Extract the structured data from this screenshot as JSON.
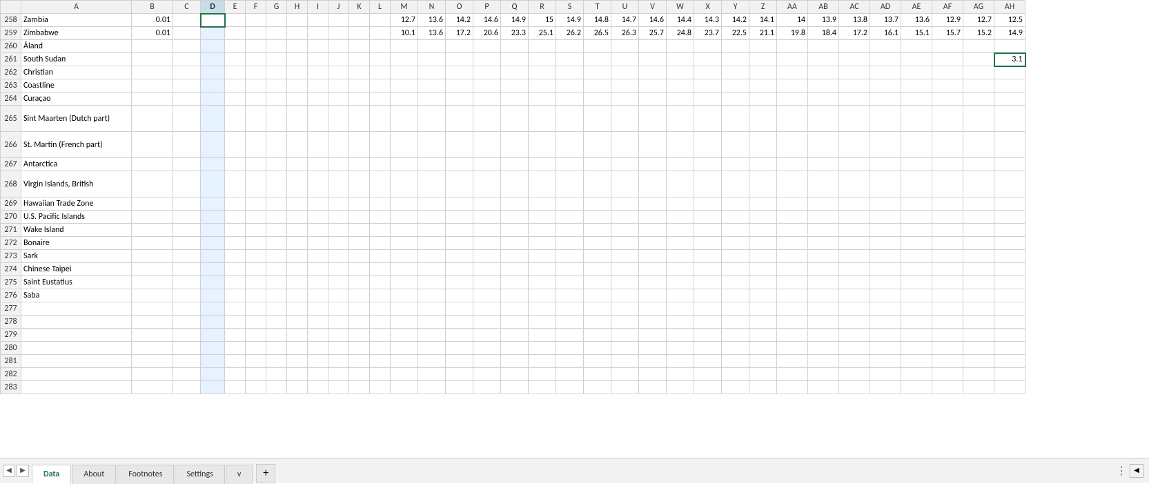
{
  "tabs": [
    {
      "label": "Data",
      "active": true
    },
    {
      "label": "About",
      "active": false
    },
    {
      "label": "Footnotes",
      "active": false
    },
    {
      "label": "Settings",
      "active": false
    },
    {
      "label": "v",
      "active": false
    }
  ],
  "tab_add_label": "+",
  "columns": [
    "",
    "A",
    "B",
    "C",
    "D",
    "E",
    "F",
    "G",
    "H",
    "I",
    "J",
    "K",
    "L",
    "M",
    "N",
    "O",
    "P",
    "Q",
    "R",
    "S",
    "T",
    "U",
    "V",
    "W",
    "X",
    "Y",
    "Z",
    "AA",
    "AB",
    "AC",
    "AD",
    "AE",
    "AF",
    "AG",
    "AH"
  ],
  "rows": [
    {
      "num": 258,
      "a": "Zambia",
      "b": "0.01",
      "c": "",
      "d": "",
      "e": "",
      "f": "",
      "g": "",
      "h": "",
      "i": "",
      "j": "",
      "k": "",
      "l": "",
      "m": "12.7",
      "n": "13.6",
      "o": "14.2",
      "p": "14.6",
      "q": "14.9",
      "r": "15",
      "s": "14.9",
      "t": "14.8",
      "u": "14.7",
      "v": "14.6",
      "w": "14.4",
      "x": "14.3",
      "y": "14.2",
      "z": "14.1",
      "aa": "14",
      "ab": "13.9",
      "ac": "13.8",
      "ad": "13.7",
      "ae": "13.6",
      "af": "12.9",
      "ag": "12.7",
      "ah": "12.5"
    },
    {
      "num": 259,
      "a": "Zimbabwe",
      "b": "0.01",
      "c": "",
      "d": "",
      "e": "",
      "f": "",
      "g": "",
      "h": "",
      "i": "",
      "j": "",
      "k": "",
      "l": "",
      "m": "10.1",
      "n": "13.6",
      "o": "17.2",
      "p": "20.6",
      "q": "23.3",
      "r": "25.1",
      "s": "26.2",
      "t": "26.5",
      "u": "26.3",
      "v": "25.7",
      "w": "24.8",
      "x": "23.7",
      "y": "22.5",
      "z": "21.1",
      "aa": "19.8",
      "ab": "18.4",
      "ac": "17.2",
      "ad": "16.1",
      "ae": "15.1",
      "af": "15.7",
      "ag": "15.2",
      "ah": "14.9"
    },
    {
      "num": 260,
      "a": "Åland",
      "b": "",
      "c": "",
      "d": "",
      "e": "",
      "f": "",
      "g": "",
      "h": "",
      "i": "",
      "j": "",
      "k": "",
      "l": "",
      "m": "",
      "n": "",
      "o": "",
      "p": "",
      "q": "",
      "r": "",
      "s": "",
      "t": "",
      "u": "",
      "v": "",
      "w": "",
      "x": "",
      "y": "",
      "z": "",
      "aa": "",
      "ab": "",
      "ac": "",
      "ad": "",
      "ae": "",
      "af": "",
      "ag": "",
      "ah": ""
    },
    {
      "num": 261,
      "a": "South Sudan",
      "b": "",
      "c": "",
      "d": "",
      "e": "",
      "f": "",
      "g": "",
      "h": "",
      "i": "",
      "j": "",
      "k": "",
      "l": "",
      "m": "",
      "n": "",
      "o": "",
      "p": "",
      "q": "",
      "r": "",
      "s": "",
      "t": "",
      "u": "",
      "v": "",
      "w": "",
      "x": "",
      "y": "",
      "z": "",
      "aa": "",
      "ab": "",
      "ac": "",
      "ad": "",
      "ae": "",
      "af": "",
      "ag": "",
      "ah": "3.1"
    },
    {
      "num": 262,
      "a": "Christian",
      "b": "",
      "c": "",
      "d": "",
      "e": "",
      "f": "",
      "g": "",
      "h": "",
      "i": "",
      "j": "",
      "k": "",
      "l": "",
      "m": "",
      "n": "",
      "o": "",
      "p": "",
      "q": "",
      "r": "",
      "s": "",
      "t": "",
      "u": "",
      "v": "",
      "w": "",
      "x": "",
      "y": "",
      "z": "",
      "aa": "",
      "ab": "",
      "ac": "",
      "ad": "",
      "ae": "",
      "af": "",
      "ag": "",
      "ah": ""
    },
    {
      "num": 263,
      "a": "Coastline",
      "b": "",
      "c": "",
      "d": "",
      "e": "",
      "f": "",
      "g": "",
      "h": "",
      "i": "",
      "j": "",
      "k": "",
      "l": "",
      "m": "",
      "n": "",
      "o": "",
      "p": "",
      "q": "",
      "r": "",
      "s": "",
      "t": "",
      "u": "",
      "v": "",
      "w": "",
      "x": "",
      "y": "",
      "z": "",
      "aa": "",
      "ab": "",
      "ac": "",
      "ad": "",
      "ae": "",
      "af": "",
      "ag": "",
      "ah": ""
    },
    {
      "num": 264,
      "a": "Curaçao",
      "b": "",
      "c": "",
      "d": "",
      "e": "",
      "f": "",
      "g": "",
      "h": "",
      "i": "",
      "j": "",
      "k": "",
      "l": "",
      "m": "",
      "n": "",
      "o": "",
      "p": "",
      "q": "",
      "r": "",
      "s": "",
      "t": "",
      "u": "",
      "v": "",
      "w": "",
      "x": "",
      "y": "",
      "z": "",
      "aa": "",
      "ab": "",
      "ac": "",
      "ad": "",
      "ae": "",
      "af": "",
      "ag": "",
      "ah": ""
    },
    {
      "num": 265,
      "a": "Sint Maarten (Dutch part)",
      "b": "",
      "c": "",
      "d": "",
      "e": "",
      "f": "",
      "g": "",
      "h": "",
      "i": "",
      "j": "",
      "k": "",
      "l": "",
      "m": "",
      "n": "",
      "o": "",
      "p": "",
      "q": "",
      "r": "",
      "s": "",
      "t": "",
      "u": "",
      "v": "",
      "w": "",
      "x": "",
      "y": "",
      "z": "",
      "aa": "",
      "ab": "",
      "ac": "",
      "ad": "",
      "ae": "",
      "af": "",
      "ag": "",
      "ah": ""
    },
    {
      "num": 266,
      "a": "St. Martin (French part)",
      "b": "",
      "c": "",
      "d": "",
      "e": "",
      "f": "",
      "g": "",
      "h": "",
      "i": "",
      "j": "",
      "k": "",
      "l": "",
      "m": "",
      "n": "",
      "o": "",
      "p": "",
      "q": "",
      "r": "",
      "s": "",
      "t": "",
      "u": "",
      "v": "",
      "w": "",
      "x": "",
      "y": "",
      "z": "",
      "aa": "",
      "ab": "",
      "ac": "",
      "ad": "",
      "ae": "",
      "af": "",
      "ag": "",
      "ah": ""
    },
    {
      "num": 267,
      "a": "Antarctica",
      "b": "",
      "c": "",
      "d": "",
      "e": "",
      "f": "",
      "g": "",
      "h": "",
      "i": "",
      "j": "",
      "k": "",
      "l": "",
      "m": "",
      "n": "",
      "o": "",
      "p": "",
      "q": "",
      "r": "",
      "s": "",
      "t": "",
      "u": "",
      "v": "",
      "w": "",
      "x": "",
      "y": "",
      "z": "",
      "aa": "",
      "ab": "",
      "ac": "",
      "ad": "",
      "ae": "",
      "af": "",
      "ag": "",
      "ah": ""
    },
    {
      "num": 268,
      "a": "Virgin Islands, British",
      "b": "",
      "c": "",
      "d": "",
      "e": "",
      "f": "",
      "g": "",
      "h": "",
      "i": "",
      "j": "",
      "k": "",
      "l": "",
      "m": "",
      "n": "",
      "o": "",
      "p": "",
      "q": "",
      "r": "",
      "s": "",
      "t": "",
      "u": "",
      "v": "",
      "w": "",
      "x": "",
      "y": "",
      "z": "",
      "aa": "",
      "ab": "",
      "ac": "",
      "ad": "",
      "ae": "",
      "af": "",
      "ag": "",
      "ah": ""
    },
    {
      "num": 269,
      "a": "Hawaiian Trade Zone",
      "b": "",
      "c": "",
      "d": "",
      "e": "",
      "f": "",
      "g": "",
      "h": "",
      "i": "",
      "j": "",
      "k": "",
      "l": "",
      "m": "",
      "n": "",
      "o": "",
      "p": "",
      "q": "",
      "r": "",
      "s": "",
      "t": "",
      "u": "",
      "v": "",
      "w": "",
      "x": "",
      "y": "",
      "z": "",
      "aa": "",
      "ab": "",
      "ac": "",
      "ad": "",
      "ae": "",
      "af": "",
      "ag": "",
      "ah": ""
    },
    {
      "num": 270,
      "a": "U.S. Pacific Islands",
      "b": "",
      "c": "",
      "d": "",
      "e": "",
      "f": "",
      "g": "",
      "h": "",
      "i": "",
      "j": "",
      "k": "",
      "l": "",
      "m": "",
      "n": "",
      "o": "",
      "p": "",
      "q": "",
      "r": "",
      "s": "",
      "t": "",
      "u": "",
      "v": "",
      "w": "",
      "x": "",
      "y": "",
      "z": "",
      "aa": "",
      "ab": "",
      "ac": "",
      "ad": "",
      "ae": "",
      "af": "",
      "ag": "",
      "ah": ""
    },
    {
      "num": 271,
      "a": "Wake Island",
      "b": "",
      "c": "",
      "d": "",
      "e": "",
      "f": "",
      "g": "",
      "h": "",
      "i": "",
      "j": "",
      "k": "",
      "l": "",
      "m": "",
      "n": "",
      "o": "",
      "p": "",
      "q": "",
      "r": "",
      "s": "",
      "t": "",
      "u": "",
      "v": "",
      "w": "",
      "x": "",
      "y": "",
      "z": "",
      "aa": "",
      "ab": "",
      "ac": "",
      "ad": "",
      "ae": "",
      "af": "",
      "ag": "",
      "ah": ""
    },
    {
      "num": 272,
      "a": "Bonaire",
      "b": "",
      "c": "",
      "d": "",
      "e": "",
      "f": "",
      "g": "",
      "h": "",
      "i": "",
      "j": "",
      "k": "",
      "l": "",
      "m": "",
      "n": "",
      "o": "",
      "p": "",
      "q": "",
      "r": "",
      "s": "",
      "t": "",
      "u": "",
      "v": "",
      "w": "",
      "x": "",
      "y": "",
      "z": "",
      "aa": "",
      "ab": "",
      "ac": "",
      "ad": "",
      "ae": "",
      "af": "",
      "ag": "",
      "ah": ""
    },
    {
      "num": 273,
      "a": "Sark",
      "b": "",
      "c": "",
      "d": "",
      "e": "",
      "f": "",
      "g": "",
      "h": "",
      "i": "",
      "j": "",
      "k": "",
      "l": "",
      "m": "",
      "n": "",
      "o": "",
      "p": "",
      "q": "",
      "r": "",
      "s": "",
      "t": "",
      "u": "",
      "v": "",
      "w": "",
      "x": "",
      "y": "",
      "z": "",
      "aa": "",
      "ab": "",
      "ac": "",
      "ad": "",
      "ae": "",
      "af": "",
      "ag": "",
      "ah": ""
    },
    {
      "num": 274,
      "a": "Chinese Taipei",
      "b": "",
      "c": "",
      "d": "",
      "e": "",
      "f": "",
      "g": "",
      "h": "",
      "i": "",
      "j": "",
      "k": "",
      "l": "",
      "m": "",
      "n": "",
      "o": "",
      "p": "",
      "q": "",
      "r": "",
      "s": "",
      "t": "",
      "u": "",
      "v": "",
      "w": "",
      "x": "",
      "y": "",
      "z": "",
      "aa": "",
      "ab": "",
      "ac": "",
      "ad": "",
      "ae": "",
      "af": "",
      "ag": "",
      "ah": ""
    },
    {
      "num": 275,
      "a": "Saint Eustatius",
      "b": "",
      "c": "",
      "d": "",
      "e": "",
      "f": "",
      "g": "",
      "h": "",
      "i": "",
      "j": "",
      "k": "",
      "l": "",
      "m": "",
      "n": "",
      "o": "",
      "p": "",
      "q": "",
      "r": "",
      "s": "",
      "t": "",
      "u": "",
      "v": "",
      "w": "",
      "x": "",
      "y": "",
      "z": "",
      "aa": "",
      "ab": "",
      "ac": "",
      "ad": "",
      "ae": "",
      "af": "",
      "ag": "",
      "ah": ""
    },
    {
      "num": 276,
      "a": "Saba",
      "b": "",
      "c": "",
      "d": "",
      "e": "",
      "f": "",
      "g": "",
      "h": "",
      "i": "",
      "j": "",
      "k": "",
      "l": "",
      "m": "",
      "n": "",
      "o": "",
      "p": "",
      "q": "",
      "r": "",
      "s": "",
      "t": "",
      "u": "",
      "v": "",
      "w": "",
      "x": "",
      "y": "",
      "z": "",
      "aa": "",
      "ab": "",
      "ac": "",
      "ad": "",
      "ae": "",
      "af": "",
      "ag": "",
      "ah": ""
    },
    {
      "num": 277,
      "a": "",
      "b": "",
      "c": "",
      "d": "",
      "e": "",
      "f": "",
      "g": "",
      "h": "",
      "i": "",
      "j": "",
      "k": "",
      "l": "",
      "m": "",
      "n": "",
      "o": "",
      "p": "",
      "q": "",
      "r": "",
      "s": "",
      "t": "",
      "u": "",
      "v": "",
      "w": "",
      "x": "",
      "y": "",
      "z": "",
      "aa": "",
      "ab": "",
      "ac": "",
      "ad": "",
      "ae": "",
      "af": "",
      "ag": "",
      "ah": ""
    },
    {
      "num": 278,
      "a": "",
      "b": "",
      "c": "",
      "d": "",
      "e": "",
      "f": "",
      "g": "",
      "h": "",
      "i": "",
      "j": "",
      "k": "",
      "l": "",
      "m": "",
      "n": "",
      "o": "",
      "p": "",
      "q": "",
      "r": "",
      "s": "",
      "t": "",
      "u": "",
      "v": "",
      "w": "",
      "x": "",
      "y": "",
      "z": "",
      "aa": "",
      "ab": "",
      "ac": "",
      "ad": "",
      "ae": "",
      "af": "",
      "ag": "",
      "ah": ""
    },
    {
      "num": 279,
      "a": "",
      "b": "",
      "c": "",
      "d": "",
      "e": "",
      "f": "",
      "g": "",
      "h": "",
      "i": "",
      "j": "",
      "k": "",
      "l": "",
      "m": "",
      "n": "",
      "o": "",
      "p": "",
      "q": "",
      "r": "",
      "s": "",
      "t": "",
      "u": "",
      "v": "",
      "w": "",
      "x": "",
      "y": "",
      "z": "",
      "aa": "",
      "ab": "",
      "ac": "",
      "ad": "",
      "ae": "",
      "af": "",
      "ag": "",
      "ah": ""
    },
    {
      "num": 280,
      "a": "",
      "b": "",
      "c": "",
      "d": "",
      "e": "",
      "f": "",
      "g": "",
      "h": "",
      "i": "",
      "j": "",
      "k": "",
      "l": "",
      "m": "",
      "n": "",
      "o": "",
      "p": "",
      "q": "",
      "r": "",
      "s": "",
      "t": "",
      "u": "",
      "v": "",
      "w": "",
      "x": "",
      "y": "",
      "z": "",
      "aa": "",
      "ab": "",
      "ac": "",
      "ad": "",
      "ae": "",
      "af": "",
      "ag": "",
      "ah": ""
    },
    {
      "num": 281,
      "a": "",
      "b": "",
      "c": "",
      "d": "",
      "e": "",
      "f": "",
      "g": "",
      "h": "",
      "i": "",
      "j": "",
      "k": "",
      "l": "",
      "m": "",
      "n": "",
      "o": "",
      "p": "",
      "q": "",
      "r": "",
      "s": "",
      "t": "",
      "u": "",
      "v": "",
      "w": "",
      "x": "",
      "y": "",
      "z": "",
      "aa": "",
      "ab": "",
      "ac": "",
      "ad": "",
      "ae": "",
      "af": "",
      "ag": "",
      "ah": ""
    },
    {
      "num": 282,
      "a": "",
      "b": "",
      "c": "",
      "d": "",
      "e": "",
      "f": "",
      "g": "",
      "h": "",
      "i": "",
      "j": "",
      "k": "",
      "l": "",
      "m": "",
      "n": "",
      "o": "",
      "p": "",
      "q": "",
      "r": "",
      "s": "",
      "t": "",
      "u": "",
      "v": "",
      "w": "",
      "x": "",
      "y": "",
      "z": "",
      "aa": "",
      "ab": "",
      "ac": "",
      "ad": "",
      "ae": "",
      "af": "",
      "ag": "",
      "ah": ""
    },
    {
      "num": 283,
      "a": "",
      "b": "",
      "c": "",
      "d": "",
      "e": "",
      "f": "",
      "g": "",
      "h": "",
      "i": "",
      "j": "",
      "k": "",
      "l": "",
      "m": "",
      "n": "",
      "o": "",
      "p": "",
      "q": "",
      "r": "",
      "s": "",
      "t": "",
      "u": "",
      "v": "",
      "w": "",
      "x": "",
      "y": "",
      "z": "",
      "aa": "",
      "ab": "",
      "ac": "",
      "ad": "",
      "ae": "",
      "af": "",
      "ag": "",
      "ah": ""
    }
  ]
}
